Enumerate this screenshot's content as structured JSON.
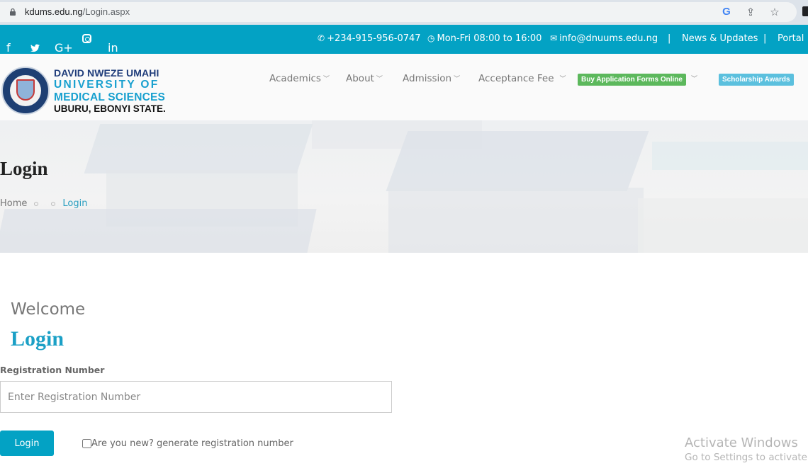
{
  "browser": {
    "url_domain": "kdums.edu.ng",
    "url_path": "/Login.aspx",
    "icons": [
      "lock-icon",
      "google-icon",
      "share-icon",
      "star-icon",
      "extensions-icon"
    ]
  },
  "topbar": {
    "social": [
      {
        "name": "facebook-icon",
        "glyph": "f"
      },
      {
        "name": "twitter-icon",
        "glyph": "🐦"
      },
      {
        "name": "google-plus-icon",
        "glyph": "G+"
      },
      {
        "name": "instagram-icon",
        "glyph": ""
      },
      {
        "name": "linkedin-icon",
        "glyph": "in"
      }
    ],
    "phone_icon": "📞",
    "phone": "+234-915-956-0747",
    "hours_icon": "◷",
    "hours": "Mon-Fri 08:00 to 16:00",
    "email_icon": "✉",
    "email": "info@dnuums.edu.ng",
    "separator": "|",
    "news_label": "News & Updates",
    "portal_label": "Portal"
  },
  "header": {
    "logo": {
      "line1": "DAVID NWEZE UMAHI",
      "line2": "UNIVERSITY OF",
      "line3": "MEDICAL SCIENCES",
      "line4": "UBURU, EBONYI STATE."
    },
    "nav": [
      {
        "label": "Academics",
        "has_dropdown": true
      },
      {
        "label": "About",
        "has_dropdown": true
      },
      {
        "label": "Admission",
        "has_dropdown": true
      },
      {
        "label": "Acceptance Fee",
        "has_dropdown": true
      },
      {
        "label": "Buy Application Forms Online",
        "has_dropdown": true,
        "badge_color": "#5cb85c"
      },
      {
        "label": "Scholarship Awards",
        "has_dropdown": false,
        "badge_color": "#5bc0de"
      }
    ],
    "chevron": "⌄"
  },
  "hero": {
    "title": "Login",
    "breadcrumb": [
      {
        "label": "Home"
      },
      {
        "label": "Login",
        "current": true
      }
    ]
  },
  "main": {
    "welcome": "Welcome",
    "title": "Login",
    "reg_label": "Registration Number",
    "reg_placeholder": "Enter Registration Number",
    "reg_value": "",
    "login_button": "Login",
    "new_checkbox_label": "Are you new? generate registration number",
    "new_checkbox_checked": false
  },
  "watermark": {
    "line1": "Activate Windows",
    "line2": "Go to Settings to activate Windows."
  },
  "colors": {
    "brand": "#03a2c4",
    "login_title": "#1ba0c6",
    "green_badge": "#5cb85c",
    "blue_badge": "#5bc0de"
  }
}
